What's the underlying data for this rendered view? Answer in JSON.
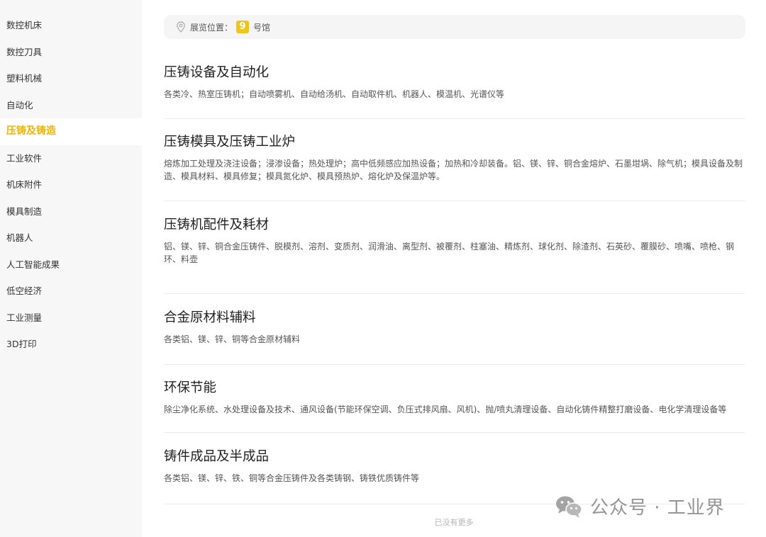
{
  "sidebar": {
    "items": [
      {
        "label": "数控机床",
        "active": false
      },
      {
        "label": "数控刀具",
        "active": false
      },
      {
        "label": "塑料机械",
        "active": false
      },
      {
        "label": "自动化",
        "active": false
      },
      {
        "label": "压铸及铸造",
        "active": true
      },
      {
        "label": "工业软件",
        "active": false
      },
      {
        "label": "机床附件",
        "active": false
      },
      {
        "label": "模具制造",
        "active": false
      },
      {
        "label": "机器人",
        "active": false
      },
      {
        "label": "人工智能成果",
        "active": false
      },
      {
        "label": "低空经济",
        "active": false
      },
      {
        "label": "工业测量",
        "active": false
      },
      {
        "label": "3D打印",
        "active": false
      }
    ],
    "accent_color": "#f0b400"
  },
  "location": {
    "label": "展览位置：",
    "hall_number": "9",
    "hall_suffix": "号馆",
    "icon": "location-pin-icon"
  },
  "sections": [
    {
      "title": "压铸设备及自动化",
      "desc": "各类冷、热室压铸机；自动喷雾机、自动给汤机、自动取件机、机器人、模温机、光谱仪等"
    },
    {
      "title": "压铸模具及压铸工业炉",
      "desc": "熔炼加工处理及浇注设备；浸渗设备；热处理炉；高中低频感应加热设备；加热和冷却装备。铝、镁、锌、铜合金熔炉、石墨坩埚、除气机；模具设备及制造、模具材料、模具修复；模具氮化炉、模具预热炉、熔化炉及保温炉等。"
    },
    {
      "title": "压铸机配件及耗材",
      "desc": "铝、镁、锌、铜合金压铸件、脱模剂、溶剂、变质剂、润滑油、离型剂、被覆剂、柱塞油、精炼剂、球化剂、除渣剂、石英砂、覆膜砂、喷嘴、喷枪、钢环、料壶"
    },
    {
      "title": "合金原材料辅料",
      "desc": "各类铝、镁、锌、铜等合金原材辅料"
    },
    {
      "title": "环保节能",
      "desc": "除尘净化系统、水处理设备及技术、通风设备(节能环保空调、负压式排风扇、风机)、抛/喷丸清理设备、自动化铸件精整打磨设备、电化学清理设备等"
    },
    {
      "title": "铸件成品及半成品",
      "desc": "各类铝、镁、锌、铁、铜等合金压铸件及各类铸钢、铸铁优质铸件等"
    }
  ],
  "footer": {
    "no_more": "已没有更多"
  },
  "watermark": {
    "text": "公众号 · 工业界",
    "icon": "wechat-logo-icon"
  }
}
